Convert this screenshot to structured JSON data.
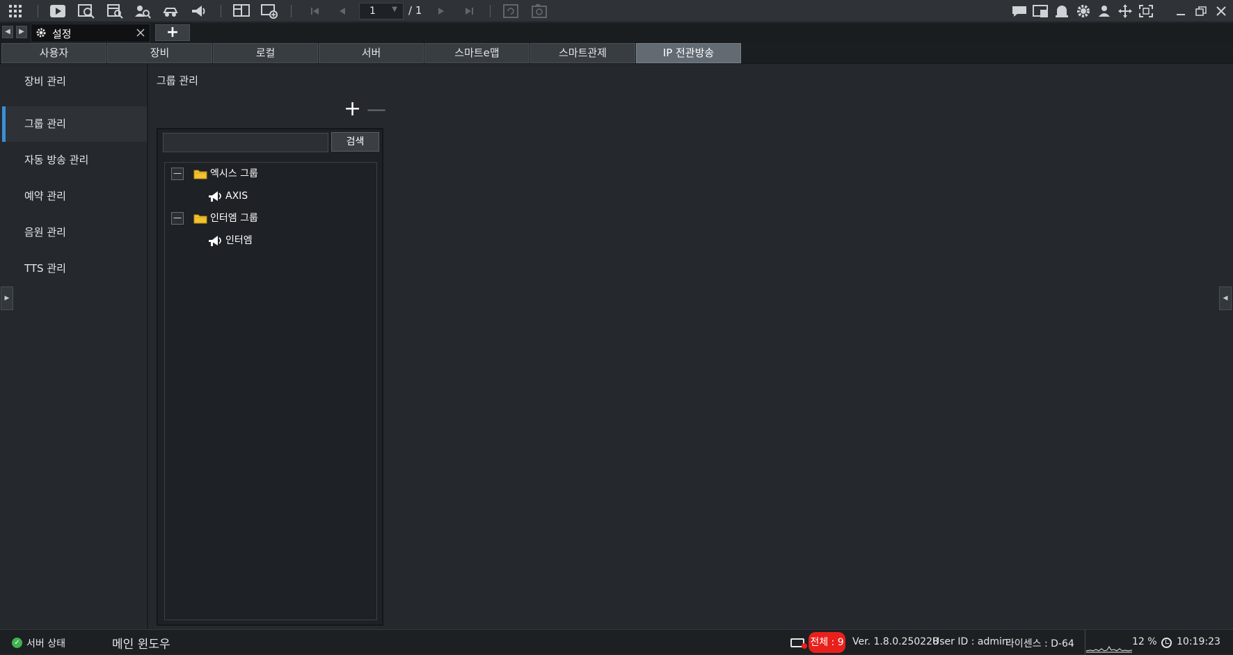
{
  "toolbar": {
    "page_number": "1",
    "page_total": "/ 1"
  },
  "tabstrip": {
    "doc_tab_label": "설정",
    "new_tab_label": "+"
  },
  "settings_tabs": [
    {
      "label": "사용자"
    },
    {
      "label": "장비"
    },
    {
      "label": "로컬"
    },
    {
      "label": "서버"
    },
    {
      "label": "스마트e맵"
    },
    {
      "label": "스마트관제"
    },
    {
      "label": "IP 전관방송"
    }
  ],
  "active_settings_tab": "IP 전관방송",
  "sidebar": {
    "items": [
      {
        "label": "장비 관리"
      },
      {
        "label": "그룹 관리"
      },
      {
        "label": "자동 방송 관리"
      },
      {
        "label": "예약 관리"
      },
      {
        "label": "음원 관리"
      },
      {
        "label": "TTS 관리"
      }
    ],
    "active_item": "그룹 관리"
  },
  "content": {
    "title": "그룹 관리",
    "search": {
      "value": "",
      "button_label": "검색"
    },
    "tree": [
      {
        "group": "엑시스 그룹",
        "expanded": true,
        "devices": [
          "AXIS"
        ]
      },
      {
        "group": "인터엠 그룹",
        "expanded": true,
        "devices": [
          "인터엠"
        ]
      }
    ]
  },
  "statusbar": {
    "server_status": "서버 상태",
    "main_window": "메인 윈도우",
    "count_badge": "전체 : 9",
    "version": "Ver. 1.8.0.250228",
    "user_id": "User ID : admin",
    "license": "라이센스 : D-64",
    "cpu": "12 %",
    "time": "10:19:23"
  },
  "colors": {
    "accent": "#3a8fd6",
    "badge": "#e8201c",
    "ok": "#3fb34f",
    "folder": "#f2c230"
  },
  "icons": {
    "toolbar": [
      "grid-icon",
      "play-icon",
      "playback-search-icon",
      "event-search-icon",
      "person-search-icon",
      "vehicle-search-icon",
      "broadcast-icon",
      "layout-icon",
      "add-screen-icon",
      "first-page-icon",
      "prev-page-icon",
      "next-page-icon",
      "last-page-icon",
      "refresh-screen-icon",
      "snapshot-icon",
      "chat-icon",
      "remote-icon",
      "alarm-icon",
      "settings-icon",
      "user-icon",
      "move-icon",
      "fullscreen-icon"
    ]
  }
}
